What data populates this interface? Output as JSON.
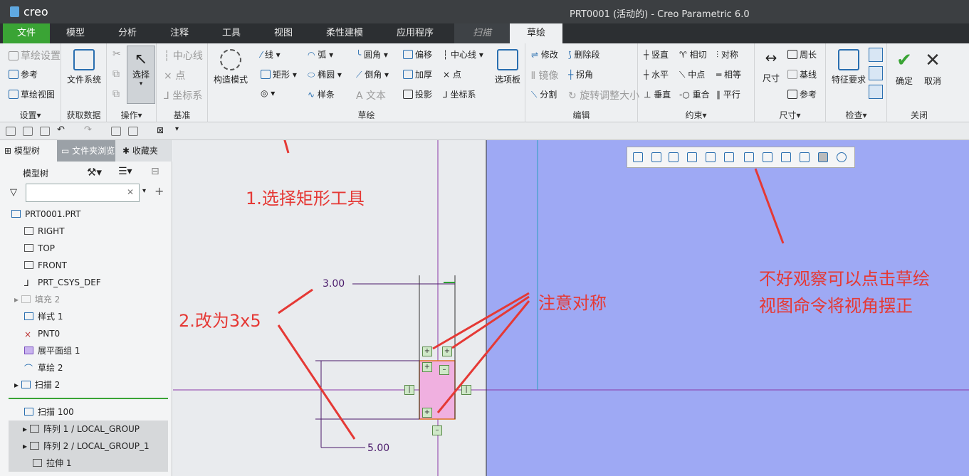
{
  "app": {
    "logo": "creo",
    "window_title": "PRT0001 (活动的) - Creo Parametric 6.0"
  },
  "tabs": [
    "文件",
    "模型",
    "分析",
    "注释",
    "工具",
    "视图",
    "柔性建模",
    "应用程序",
    "扫描",
    "草绘"
  ],
  "ribbon": {
    "settings": {
      "items": [
        "草绘设置",
        "参考",
        "草绘视图"
      ],
      "label": "设置▾"
    },
    "getdata": {
      "button": "文件系统",
      "label": "获取数据"
    },
    "ops": {
      "select": "选择",
      "label": "操作▾"
    },
    "datum": {
      "items": [
        "中心线",
        "点",
        "坐标系"
      ],
      "label": "基准"
    },
    "construct": {
      "button": "构造模式"
    },
    "sketch": {
      "col1": [
        "线 ▾",
        "矩形 ▾",
        "◎ ▾"
      ],
      "col2": [
        "弧 ▾",
        "椭圆 ▾",
        "样条"
      ],
      "col3": [
        "圆角 ▾",
        "倒角 ▾",
        "文本"
      ],
      "col4": [
        "偏移",
        "加厚",
        "投影"
      ],
      "col5": [
        "中心线 ▾",
        "点",
        "坐标系"
      ],
      "palette": "选项板",
      "label": "草绘"
    },
    "edit": {
      "items": [
        "修改",
        "删除段",
        "镜像",
        "拐角",
        "分割",
        "旋转调整大小"
      ],
      "label": "编辑"
    },
    "constrain": {
      "items": [
        "竖直",
        "相切",
        "对称",
        "水平",
        "中点",
        "相等",
        "垂直",
        "重合",
        "平行"
      ],
      "label": "约束▾"
    },
    "dimension": {
      "button": "尺寸",
      "items": [
        "周长",
        "基线",
        "参考"
      ],
      "label": "尺寸▾"
    },
    "inspect": {
      "button": "特征要求",
      "label": "检查▾"
    },
    "close": {
      "ok": "确定",
      "cancel": "取消",
      "label": "关闭"
    }
  },
  "left_pane": {
    "tabs": [
      "模型树",
      "文件夹浏览器",
      "收藏夹"
    ],
    "tree_header": "模型树",
    "filter_placeholder": "",
    "tree": [
      "PRT0001.PRT",
      "RIGHT",
      "TOP",
      "FRONT",
      "PRT_CSYS_DEF",
      "填充 2",
      "样式 1",
      "PNT0",
      "展平面组 1",
      "草绘 2",
      "扫描 2",
      "扫描 100",
      "阵列 1 / LOCAL_GROUP",
      "阵列 2 / LOCAL_GROUP_1",
      "拉伸 1"
    ]
  },
  "canvas": {
    "annotations": {
      "step1": "1.选择矩形工具",
      "step2": "2.改为3x5",
      "symmetry": "注意对称",
      "tip_line1": "不好观察可以点击草绘",
      "tip_line2": "视图命令将视角摆正"
    },
    "dims": {
      "width": "3.00",
      "height": "5.00"
    }
  },
  "colors": {
    "accent_file_tab": "#3aa435",
    "annotation": "#e53935",
    "blue_region": "#9ea9f4"
  }
}
